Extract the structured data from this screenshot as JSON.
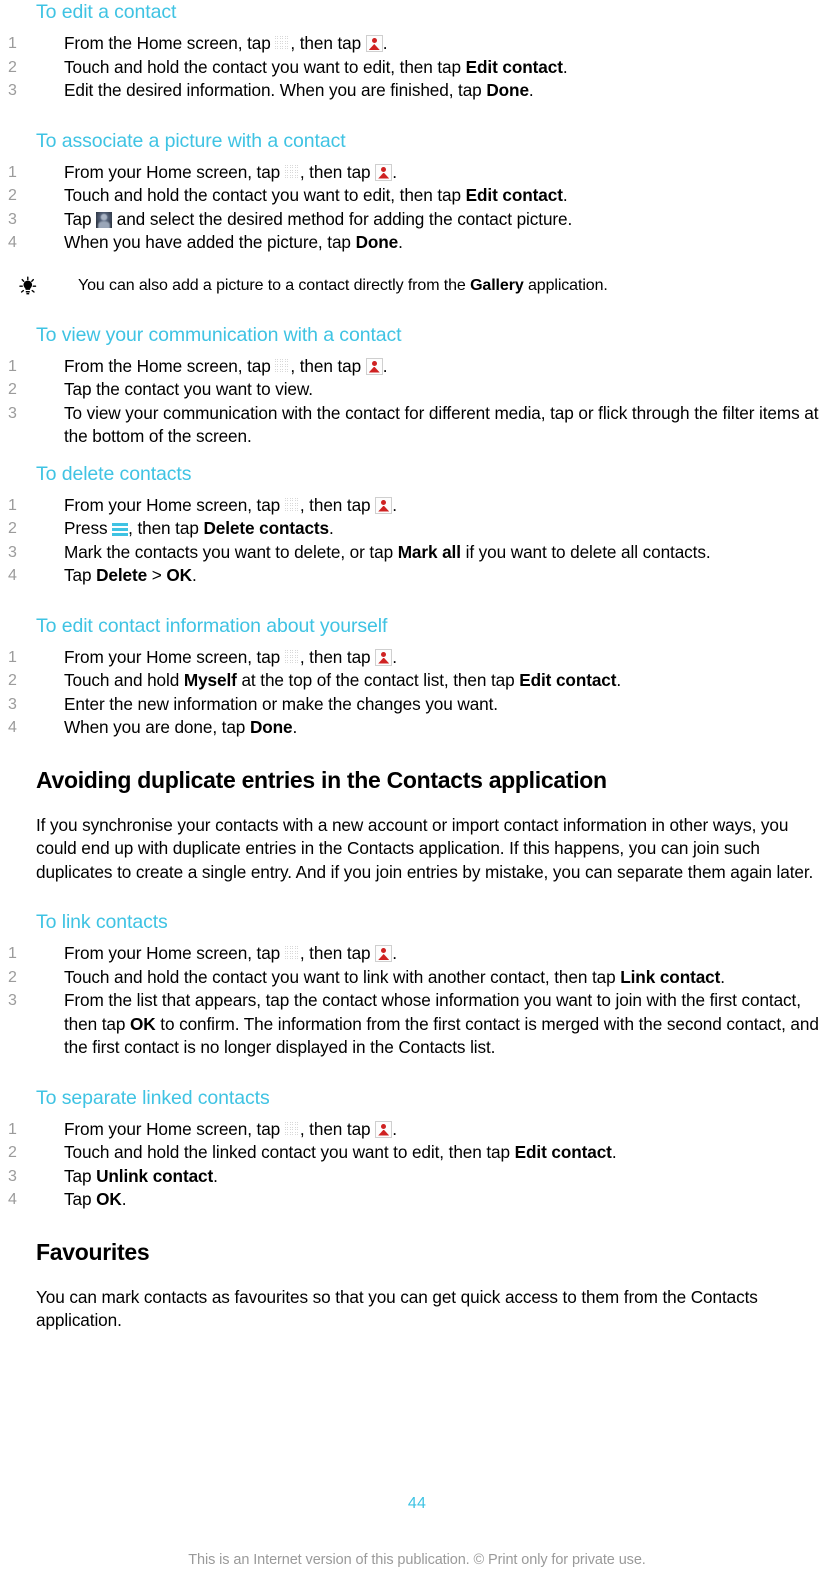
{
  "document": {
    "page_number": "44",
    "copyright_notice": "This is an Internet version of this publication. © Print only for private use.",
    "accent_color": "#3FC3E3",
    "number_color": "#9B9B9B"
  },
  "icons": {
    "grid": "app-drawer-grid-icon",
    "contacts": "contacts-person-icon",
    "avatar": "avatar-placeholder-icon",
    "menu": "menu-hamburger-icon",
    "tip": "lightbulb-tip-icon"
  },
  "sections": {
    "edit_contact": {
      "heading": "To edit a contact",
      "steps": [
        {
          "before": "From the Home screen, tap ",
          "icon1": "grid",
          "mid": ", then tap ",
          "icon2": "contacts",
          "after": "."
        },
        {
          "before": "Touch and hold the contact you want to edit, then tap ",
          "bold": "Edit contact",
          "after": "."
        },
        {
          "before": "Edit the desired information. When you are finished, tap ",
          "bold": "Done",
          "after": "."
        }
      ]
    },
    "associate_picture": {
      "heading": "To associate a picture with a contact",
      "steps": [
        {
          "before": "From your Home screen, tap ",
          "icon1": "grid",
          "mid": ", then tap ",
          "icon2": "contacts",
          "after": "."
        },
        {
          "before": "Touch and hold the contact you want to edit, then tap ",
          "bold": "Edit contact",
          "after": "."
        },
        {
          "before": "Tap ",
          "icon1": "avatar",
          "mid": " and select the desired method for adding the contact picture.",
          "after": ""
        },
        {
          "before": "When you have added the picture, tap ",
          "bold": "Done",
          "after": "."
        }
      ],
      "tip": {
        "before": "You can also add a picture to a contact directly from the ",
        "bold": "Gallery",
        "after": " application."
      }
    },
    "view_communication": {
      "heading": "To view your communication with a contact",
      "steps": [
        {
          "before": "From the Home screen, tap ",
          "icon1": "grid",
          "mid": ", then tap ",
          "icon2": "contacts",
          "after": "."
        },
        {
          "before": "Tap the contact you want to view.",
          "after": ""
        },
        {
          "before": "To view your communication with the contact for different media, tap or flick through the filter items at the bottom of the screen.",
          "after": ""
        }
      ]
    },
    "delete_contacts": {
      "heading": "To delete contacts",
      "steps": [
        {
          "before": "From your Home screen, tap ",
          "icon1": "grid",
          "mid": ", then tap ",
          "icon2": "contacts",
          "after": "."
        },
        {
          "before": "Press ",
          "icon1": "menu",
          "mid": ", then tap ",
          "bold": "Delete contacts",
          "after": "."
        },
        {
          "before": "Mark the contacts you want to delete, or tap ",
          "bold": "Mark all",
          "after": " if you want to delete all contacts."
        },
        {
          "before": "Tap ",
          "bold": "Delete",
          "mid": " > ",
          "bold2": "OK",
          "after": "."
        }
      ]
    },
    "edit_own_info": {
      "heading": "To edit contact information about yourself",
      "steps": [
        {
          "before": "From your Home screen, tap ",
          "icon1": "grid",
          "mid": ", then tap ",
          "icon2": "contacts",
          "after": "."
        },
        {
          "before": "Touch and hold ",
          "bold": "Myself",
          "mid": " at the top of the contact list, then tap ",
          "bold2": "Edit contact",
          "after": "."
        },
        {
          "before": "Enter the new information or make the changes you want.",
          "after": ""
        },
        {
          "before": "When you are done, tap ",
          "bold": "Done",
          "after": "."
        }
      ]
    },
    "avoiding_duplicates": {
      "heading": "Avoiding duplicate entries in the Contacts application",
      "body": "If you synchronise your contacts with a new account or import contact information in other ways, you could end up with duplicate entries in the Contacts application. If this happens, you can join such duplicates to create a single entry. And if you join entries by mistake, you can separate them again later."
    },
    "link_contacts": {
      "heading": "To link contacts",
      "steps": [
        {
          "before": "From your Home screen, tap ",
          "icon1": "grid",
          "mid": ", then tap ",
          "icon2": "contacts",
          "after": "."
        },
        {
          "before": "Touch and hold the contact you want to link with another contact, then tap ",
          "bold": "Link contact",
          "after": "."
        },
        {
          "before": "From the list that appears, tap the contact whose information you want to join with the first contact, then tap ",
          "bold": "OK",
          "after": " to confirm. The information from the first contact is merged with the second contact, and the first contact is no longer displayed in the Contacts list."
        }
      ]
    },
    "separate_linked": {
      "heading": "To separate linked contacts",
      "steps": [
        {
          "before": "From your Home screen, tap ",
          "icon1": "grid",
          "mid": ", then tap ",
          "icon2": "contacts",
          "after": "."
        },
        {
          "before": "Touch and hold the linked contact you want to edit, then tap ",
          "bold": "Edit contact",
          "after": "."
        },
        {
          "before": "Tap ",
          "bold": "Unlink contact",
          "after": "."
        },
        {
          "before": "Tap ",
          "bold": "OK",
          "after": "."
        }
      ]
    },
    "favourites": {
      "heading": "Favourites",
      "body": "You can mark contacts as favourites so that you can get quick access to them from the Contacts application."
    }
  }
}
